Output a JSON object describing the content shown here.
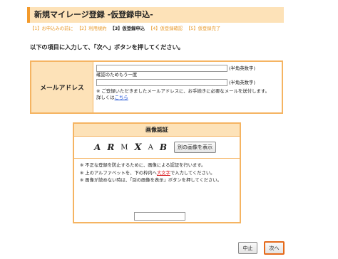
{
  "header": {
    "title": "新規マイレージ登録 -仮登録申込-"
  },
  "steps": [
    {
      "label": "【1】お申込みの前に"
    },
    {
      "label": "【2】利用規約"
    },
    {
      "label": "【3】仮登録申込"
    },
    {
      "label": "【4】仮登録確認"
    },
    {
      "label": "【5】仮登録完了"
    }
  ],
  "current_step": 3,
  "instruction": "以下の項目に入力して、「次へ」ボタンを押してください。",
  "mail": {
    "label": "メールアドレス",
    "input_value": "",
    "input_hint": "(半角英数字)",
    "confirm_label": "確認のためもう一度",
    "confirm_value": "",
    "confirm_hint": "(半角英数字)",
    "note": "※ ご登録いただきましたメールアドレスに、お手続きに必要なメールを送付します。",
    "more_prefix": "詳しくは",
    "more_link": "こちら"
  },
  "captcha": {
    "title": "画像認証",
    "chars": [
      "A",
      "R",
      "M",
      "X",
      "A",
      "B"
    ],
    "regen_button": "別の画像を表示",
    "note1": "※ 不正な登録を防止するために、画像による認証を行います。",
    "note2_prefix": "※ 上のアルファベットを、下の枠内へ",
    "note2_em": "大文字",
    "note2_suffix": "で入力してください。",
    "note3": "※ 画像が読めない時は、「別の画像を表示」ボタンを押してください。",
    "input_value": ""
  },
  "buttons": {
    "cancel": "中止",
    "next": "次へ"
  },
  "colors": {
    "accent": "#f39a2b",
    "header_bg": "#fde2b8",
    "border": "#f5b462",
    "link": "#1a4fd6",
    "emphasis": "#d8161b",
    "next_border": "#e56a1b"
  }
}
